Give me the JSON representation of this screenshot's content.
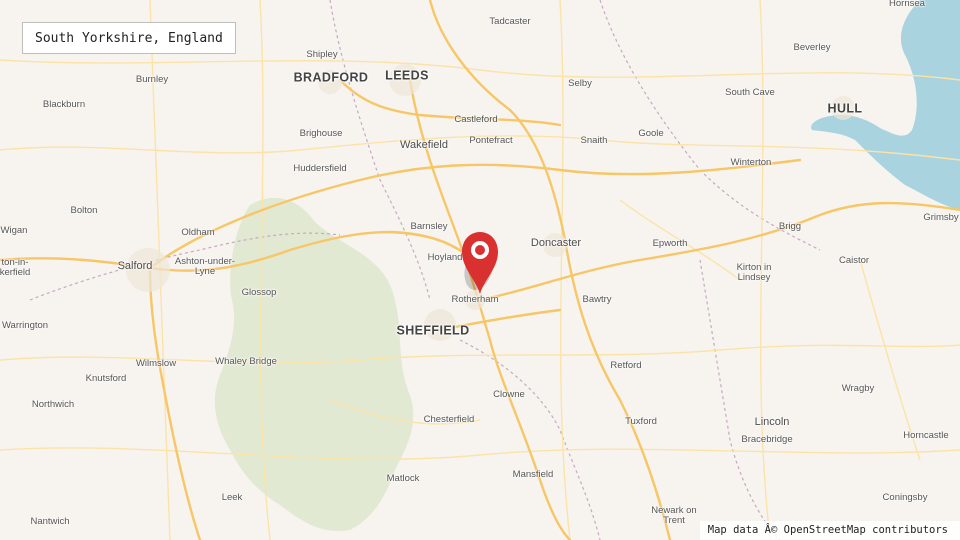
{
  "title": "South Yorkshire, England",
  "attribution": "Map data Â© OpenStreetMap contributors",
  "marker": {
    "icon": "map-pin-icon",
    "color": "#d93030"
  },
  "places": {
    "hornsea": "Hornsea",
    "tadcaster": "Tadcaster",
    "beverley": "Beverley",
    "shipley": "Shipley",
    "bradford": "BRADFORD",
    "leeds": "LEEDS",
    "burnley": "Burnley",
    "selby": "Selby",
    "south_cave": "South Cave",
    "hull": "HULL",
    "blackburn": "Blackburn",
    "castleford": "Castleford",
    "brighouse": "Brighouse",
    "goole": "Goole",
    "wakefield": "Wakefield",
    "pontefract": "Pontefract",
    "snaith": "Snaith",
    "winterton": "Winterton",
    "huddersfield": "Huddersfield",
    "bolton": "Bolton",
    "barnsley": "Barnsley",
    "brigg": "Brigg",
    "grimsby": "Grimsby",
    "wigan": "Wigan",
    "oldham": "Oldham",
    "doncaster": "Doncaster",
    "epworth": "Epworth",
    "ashton_under_lyne": "Ashton-under-\nLyne",
    "hoyland": "Hoyland",
    "caistor": "Caistor",
    "ashton_in_makerfield": "ton-in-\nkerfield",
    "salford": "Salford",
    "kirton_in_lindsey": "Kirton in\nLindsey",
    "glossop": "Glossop",
    "rotherham": "Rotherham",
    "bawtry": "Bawtry",
    "warrington": "Warrington",
    "sheffield": "SHEFFIELD",
    "wilmslow": "Wilmslow",
    "whaley_bridge": "Whaley Bridge",
    "retford": "Retford",
    "knutsford": "Knutsford",
    "wragby": "Wragby",
    "clowne": "Clowne",
    "northwich": "Northwich",
    "chesterfield": "Chesterfield",
    "tuxford": "Tuxford",
    "lincoln": "Lincoln",
    "horncastle": "Horncastle",
    "bracebridge": "Bracebridge",
    "mansfield": "Mansfield",
    "matlock": "Matlock",
    "leek": "Leek",
    "coningsby": "Coningsby",
    "newark_on_trent": "Newark on\nTrent",
    "nantwich": "Nantwich"
  },
  "colors": {
    "land": "#f7f4ef",
    "park": "#dfe8cf",
    "water": "#a9d3de",
    "road_major": "#f6c667",
    "road_minor": "#fbe3a8",
    "boundary": "#c6a8c4",
    "marker": "#d93030"
  }
}
